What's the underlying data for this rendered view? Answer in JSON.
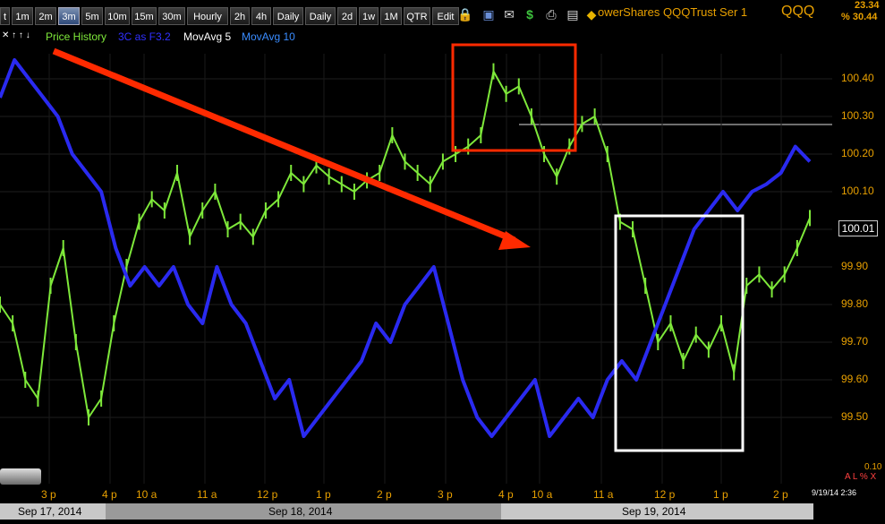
{
  "toolbar": {
    "buttons": [
      "t",
      "1m",
      "2m",
      "3m",
      "5m",
      "10m",
      "15m",
      "30m",
      "Hourly",
      "2h",
      "4h",
      "Daily",
      "Daily",
      "2d",
      "1w",
      "1M",
      "QTR",
      "Edit"
    ],
    "active": "3m",
    "instrument_name": "owerShares QQQTrust Ser 1",
    "symbol": "QQQ",
    "last_change": "23.34",
    "pct_change": "% 30.44"
  },
  "legend": {
    "arrows": "✕ ↑ ↑ ↓",
    "price_history": "Price History",
    "indicator": "3C as F3.2",
    "ma5": "MovAvg 5",
    "ma10": "MovAvg 10"
  },
  "colors": {
    "price": "#7ee83a",
    "indicator": "#2a2af0",
    "axis_text": "#e8a000",
    "annotation_arrow": "#ff2a00",
    "box_red": "#ff2a00",
    "box_white": "#ffffff"
  },
  "chart_data": {
    "type": "line",
    "title": "",
    "xlabel": "",
    "ylabel": "",
    "ylim": [
      99.4,
      100.46
    ],
    "y_ticks": [
      "100.40",
      "100.30",
      "100.20",
      "100.10",
      "100.00",
      "99.90",
      "99.80",
      "99.70",
      "99.60",
      "99.50"
    ],
    "last_price": "100.01",
    "x_ticks": [
      "3 p",
      "4 p",
      "10 a",
      "11 a",
      "12 p",
      "1 p",
      "2 p",
      "3 p",
      "4 p",
      "10 a",
      "11 a",
      "12 p",
      "1 p",
      "2 p"
    ],
    "dates": [
      "Sep 17, 2014",
      "Sep 18, 2014",
      "Sep 19, 2014"
    ],
    "timestamp": "9/19/14 2:36",
    "bottom_value": "0.10",
    "bottom_flags": "A L % X",
    "series": [
      {
        "name": "Price History",
        "values": [
          99.8,
          99.75,
          99.6,
          99.55,
          99.85,
          99.95,
          99.7,
          99.5,
          99.55,
          99.75,
          99.9,
          100.02,
          100.08,
          100.05,
          100.15,
          99.98,
          100.05,
          100.1,
          100.0,
          100.02,
          99.98,
          100.05,
          100.08,
          100.15,
          100.12,
          100.17,
          100.14,
          100.12,
          100.1,
          100.13,
          100.15,
          100.25,
          100.18,
          100.15,
          100.12,
          100.18,
          100.2,
          100.22,
          100.25,
          100.42,
          100.36,
          100.38,
          100.3,
          100.2,
          100.14,
          100.22,
          100.28,
          100.3,
          100.2,
          100.02,
          100.0,
          99.85,
          99.7,
          99.75,
          99.65,
          99.72,
          99.68,
          99.75,
          99.62,
          99.85,
          99.88,
          99.84,
          99.88,
          99.95,
          100.03
        ]
      },
      {
        "name": "3C as F3.2",
        "values": [
          100.35,
          100.45,
          100.4,
          100.35,
          100.3,
          100.2,
          100.15,
          100.1,
          99.95,
          99.85,
          99.9,
          99.85,
          99.9,
          99.8,
          99.75,
          99.9,
          99.8,
          99.75,
          99.65,
          99.55,
          99.6,
          99.45,
          99.5,
          99.55,
          99.6,
          99.65,
          99.75,
          99.7,
          99.8,
          99.85,
          99.9,
          99.75,
          99.6,
          99.5,
          99.45,
          99.5,
          99.55,
          99.6,
          99.45,
          99.5,
          99.55,
          99.5,
          99.6,
          99.65,
          99.6,
          99.7,
          99.8,
          99.9,
          100.0,
          100.05,
          100.1,
          100.05,
          100.1,
          100.12,
          100.15,
          100.22,
          100.18
        ]
      }
    ],
    "annotations": [
      "red-arrow",
      "red-box",
      "white-box"
    ]
  }
}
